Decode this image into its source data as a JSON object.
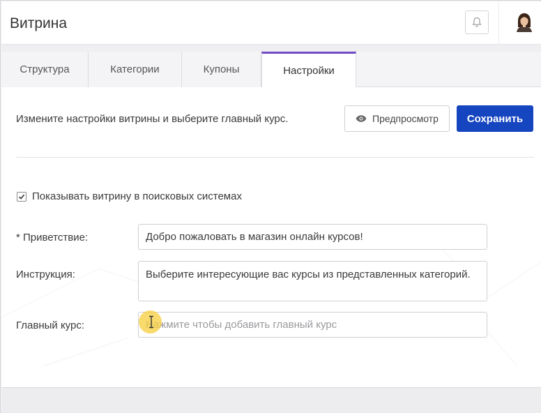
{
  "header": {
    "title": "Витрина",
    "bell_icon": "bell-icon",
    "avatar_icon": "user-avatar"
  },
  "tabs": [
    {
      "label": "Структура",
      "active": false
    },
    {
      "label": "Категории",
      "active": false
    },
    {
      "label": "Купоны",
      "active": false
    },
    {
      "label": "Настройки",
      "active": true
    }
  ],
  "toolbar": {
    "description": "Измените настройки витрины и выберите главный курс.",
    "preview_label": "Предпросмотр",
    "preview_icon": "eye-icon",
    "save_label": "Сохранить"
  },
  "settings": {
    "search_visible_label": "Показывать витрину в поисковых системах",
    "search_visible_checked": true,
    "greeting_label": "* Приветствие:",
    "greeting_value": "Добро пожаловать в магазин онлайн курсов!",
    "instruction_label": "Инструкция:",
    "instruction_value": "Выберите интересующие вас курсы из представленных категорий.",
    "main_course_label": "Главный курс:",
    "main_course_placeholder": "Нажмите чтобы добавить главный курс"
  },
  "colors": {
    "accent": "#6f49c8",
    "primary_button": "#1645c0"
  }
}
